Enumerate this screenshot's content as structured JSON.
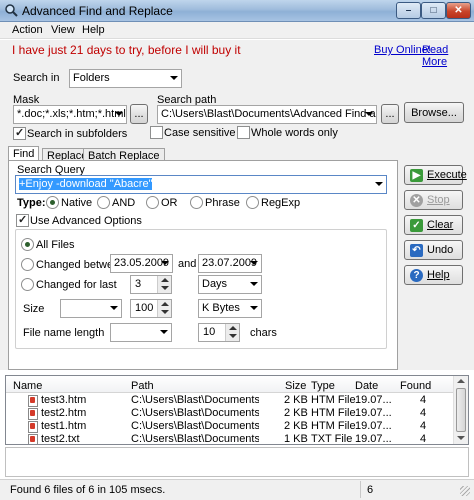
{
  "window": {
    "title": "Advanced Find and Replace",
    "min_glyph": "–",
    "max_glyph": "□",
    "close_glyph": "✕"
  },
  "menu": [
    "Action",
    "View",
    "Help"
  ],
  "trial": {
    "message": "I have just 21 days to try, before I will buy it",
    "buy_link": "Buy Online!",
    "readme_link": "Read More"
  },
  "search_in": {
    "label": "Search in",
    "value": "Folders"
  },
  "mask": {
    "label": "Mask",
    "value": "*.doc;*.xls;*.htm;*.html;*.as",
    "browse_small": "..."
  },
  "search_path": {
    "label": "Search path",
    "value": "C:\\Users\\Blast\\Documents\\Advanced Find and Repla",
    "browse_small": "...",
    "browse": "Browse..."
  },
  "options": {
    "subfolders": "Search in subfolders",
    "case_sensitive": "Case sensitive",
    "whole_words": "Whole words only"
  },
  "tabs": [
    "Find",
    "Replace",
    "Batch Replace"
  ],
  "query": {
    "label": "Search Query",
    "value": "+Enjoy -download \"Abacre\"",
    "type_label": "Type:",
    "types": [
      "Native",
      "AND",
      "OR",
      "Phrase",
      "RegExp"
    ],
    "selected_type": "Native"
  },
  "advanced": {
    "checkbox": "Use Advanced Options",
    "all_files": "All Files",
    "changed_between": "Changed between",
    "date_from": "23.05.2009",
    "and_label": "and",
    "date_to": "23.07.2009",
    "changed_last": "Changed for last",
    "last_value": "3",
    "last_unit": "Days",
    "size_label": "Size",
    "size_op": "",
    "size_value": "100",
    "size_unit": "K Bytes",
    "name_len_label": "File name length",
    "name_len_op": "",
    "name_len_value": "10",
    "chars_label": "chars"
  },
  "side_buttons": [
    {
      "label": "Execute",
      "icon": "play-icon",
      "color": "#3a9a3a",
      "glyph": "▶",
      "enabled": true
    },
    {
      "label": "Stop",
      "icon": "stop-icon",
      "color": "#8a8a8a",
      "glyph": "✕",
      "enabled": false
    },
    {
      "label": "Clear",
      "icon": "clear-icon",
      "color": "#3a9a3a",
      "glyph": "✓",
      "enabled": true
    },
    {
      "label": "Undo",
      "icon": "undo-icon",
      "color": "#2a6ac0",
      "glyph": "↶",
      "enabled": true
    },
    {
      "label": "Help",
      "icon": "help-icon",
      "color": "#2a6ac0",
      "glyph": "?",
      "enabled": true
    }
  ],
  "results": {
    "headers": [
      "Name",
      "Path",
      "Size",
      "Type",
      "Date",
      "Found"
    ],
    "rows": [
      {
        "name": "test3.htm",
        "path": "C:\\Users\\Blast\\Documents\\Adv...",
        "size": "2 KB",
        "type": "HTM File",
        "date": "19.07...",
        "found": "4"
      },
      {
        "name": "test2.htm",
        "path": "C:\\Users\\Blast\\Documents\\Adv...",
        "size": "2 KB",
        "type": "HTM File",
        "date": "19.07...",
        "found": "4"
      },
      {
        "name": "test1.htm",
        "path": "C:\\Users\\Blast\\Documents\\Adv...",
        "size": "2 KB",
        "type": "HTM File",
        "date": "19.07...",
        "found": "4"
      },
      {
        "name": "test2.txt",
        "path": "C:\\Users\\Blast\\Documents\\Adv...",
        "size": "1 KB",
        "type": "TXT File",
        "date": "19.07...",
        "found": "4"
      }
    ]
  },
  "status": {
    "message": "Found 6 files of 6 in 105 msecs.",
    "count": "6"
  }
}
